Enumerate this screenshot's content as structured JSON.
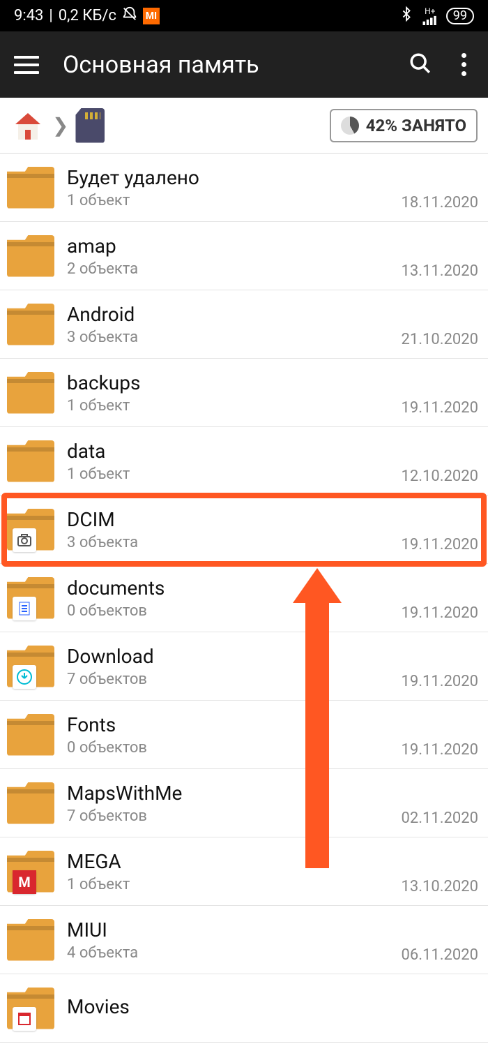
{
  "status": {
    "time": "9:43",
    "separator": "|",
    "speed": "0,2 КБ/с",
    "battery": "99",
    "signal_top": "H+",
    "signal_bottom": ""
  },
  "appbar": {
    "title": "Основная память"
  },
  "breadcrumb": {
    "storage_label": "42% ЗАНЯТО"
  },
  "annotation": {
    "highlight_index": 5
  },
  "items": [
    {
      "name": "Будет удалено",
      "sub": "1 объект",
      "date": "18.11.2020",
      "overlay": null
    },
    {
      "name": "amap",
      "sub": "2 объекта",
      "date": "13.11.2020",
      "overlay": null
    },
    {
      "name": "Android",
      "sub": "3 объекта",
      "date": "21.10.2020",
      "overlay": null
    },
    {
      "name": "backups",
      "sub": "1 объект",
      "date": "19.11.2020",
      "overlay": null
    },
    {
      "name": "data",
      "sub": "1 объект",
      "date": "12.10.2020",
      "overlay": null
    },
    {
      "name": "DCIM",
      "sub": "3 объекта",
      "date": "19.11.2020",
      "overlay": "camera"
    },
    {
      "name": "documents",
      "sub": "0 объектов",
      "date": "19.11.2020",
      "overlay": "document"
    },
    {
      "name": "Download",
      "sub": "7 объектов",
      "date": "19.11.2020",
      "overlay": "download"
    },
    {
      "name": "Fonts",
      "sub": "0 объектов",
      "date": "19.11.2020",
      "overlay": null
    },
    {
      "name": "MapsWithMe",
      "sub": "7 объектов",
      "date": "02.11.2020",
      "overlay": null
    },
    {
      "name": "MEGA",
      "sub": "1 объект",
      "date": "13.10.2020",
      "overlay": "mega"
    },
    {
      "name": "MIUI",
      "sub": "4 объекта",
      "date": "06.11.2020",
      "overlay": null
    },
    {
      "name": "Movies",
      "sub": "",
      "date": "",
      "overlay": "movie"
    }
  ]
}
